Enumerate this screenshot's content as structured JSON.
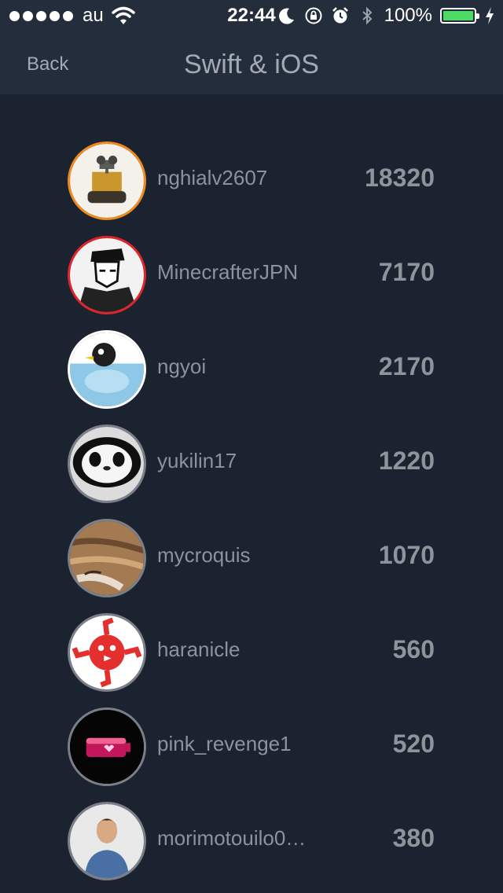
{
  "status_bar": {
    "carrier": "au",
    "time": "22:44",
    "battery_percent": "100%",
    "battery_level": 1.0,
    "icons": [
      "signal-icon",
      "wifi-icon",
      "moon-icon",
      "orientation-lock-icon",
      "alarm-icon",
      "bluetooth-icon",
      "battery-icon",
      "charging-icon"
    ]
  },
  "nav": {
    "back_label": "Back",
    "title": "Swift & iOS"
  },
  "colors": {
    "background": "#1b2230",
    "bar": "#232d3c",
    "rank1_ring": "#f08a1c",
    "rank2_ring": "#e0242a",
    "rank3_ring": "#ffffff",
    "default_ring": "#7b8088",
    "battery": "#4cd964"
  },
  "ranking": [
    {
      "username": "nghialv2607",
      "score": "18320",
      "avatar": "robot-avatar"
    },
    {
      "username": "MinecrafterJPN",
      "score": "7170",
      "avatar": "manga-avatar"
    },
    {
      "username": "ngyoi",
      "score": "2170",
      "avatar": "penguin-avatar"
    },
    {
      "username": "yukilin17",
      "score": "1220",
      "avatar": "panda-avatar"
    },
    {
      "username": "mycroquis",
      "score": "1070",
      "avatar": "cat-avatar"
    },
    {
      "username": "haranicle",
      "score": "560",
      "avatar": "logo-avatar"
    },
    {
      "username": "pink_revenge1",
      "score": "520",
      "avatar": "battery-avatar"
    },
    {
      "username": "morimotouilo0…",
      "score": "380",
      "avatar": "person-avatar"
    }
  ]
}
